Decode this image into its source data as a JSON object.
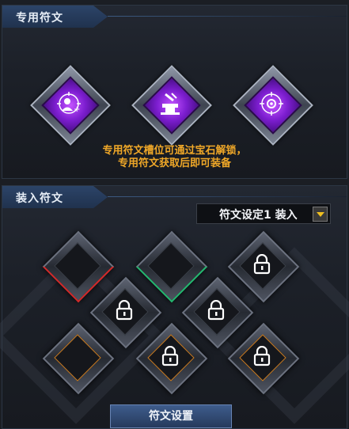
{
  "exclusive_section": {
    "title": "专用符文",
    "notice_line1": "专用符文槽位可通过宝石解锁，",
    "notice_line2": "专用符文获取后即可装备",
    "slots": [
      {
        "icon": "person-plus-icon"
      },
      {
        "icon": "anvil-icon"
      },
      {
        "icon": "target-icon"
      }
    ]
  },
  "equip_section": {
    "title": "装入符文",
    "preset_select": {
      "value": "符文设定1 装入"
    },
    "settings_button": "符文设置"
  },
  "colors": {
    "accent_gold": "#f0a828",
    "gem_purple": "#9a32e8",
    "red_edge": "#d42a2a",
    "green_edge": "#24b870",
    "orange_edge": "#c87a20"
  }
}
